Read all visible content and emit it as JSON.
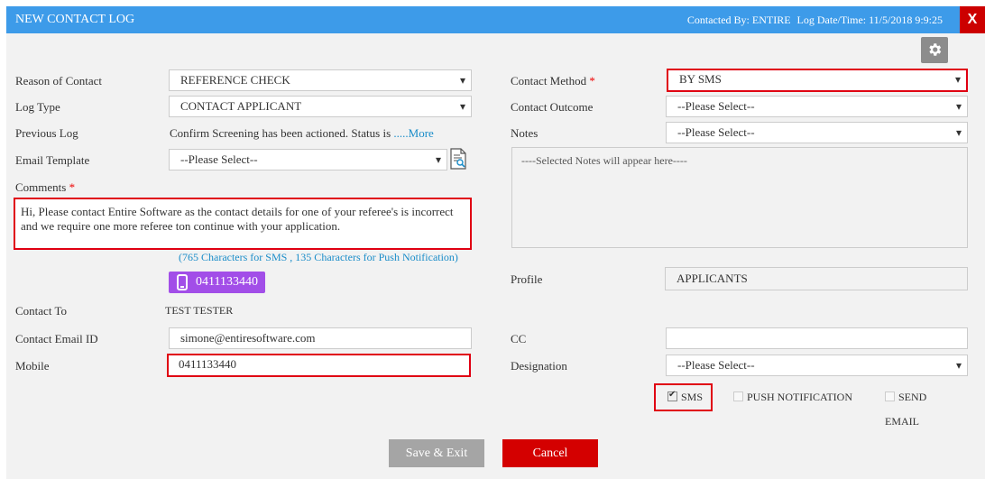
{
  "header": {
    "title": "NEW CONTACT LOG",
    "contacted_by": "Contacted By: ENTIRE",
    "log_datetime": "Log Date/Time: 11/5/2018 9:9:25",
    "close_label": "X"
  },
  "left": {
    "reason_label": "Reason of Contact",
    "reason_value": "REFERENCE CHECK",
    "logtype_label": "Log Type",
    "logtype_value": "CONTACT APPLICANT",
    "prevlog_label": "Previous Log",
    "prevlog_value": "Confirm Screening has been actioned. Status is ",
    "prevlog_more": ".....More",
    "emailtpl_label": "Email Template",
    "emailtpl_value": "--Please Select--",
    "comments_label": "Comments",
    "comments_value": "Hi, Please contact Entire Software as the contact details for one of your referee's is incorrect and we require one more referee ton continue with your application.",
    "char_info": "(765 Characters for SMS , 135 Characters for Push Notification)",
    "phone_button": "0411133440",
    "contactto_label": "Contact To",
    "contactto_value": "TEST TESTER",
    "email_label": "Contact Email ID",
    "email_value": "simone@entiresoftware.com",
    "mobile_label": "Mobile",
    "mobile_value": "0411133440"
  },
  "right": {
    "method_label": "Contact Method",
    "method_value": "BY SMS",
    "outcome_label": "Contact Outcome",
    "outcome_value": "--Please Select--",
    "notes_label": "Notes",
    "notes_value": "--Please Select--",
    "notes_placeholder": "----Selected Notes will appear here----",
    "profile_label": "Profile",
    "profile_value": "APPLICANTS",
    "cc_label": "CC",
    "cc_value": "",
    "designation_label": "Designation",
    "designation_value": "--Please Select--",
    "sms_label": "SMS",
    "sms_checked": true,
    "push_label": "PUSH NOTIFICATION",
    "push_checked": false,
    "send_label": "SEND",
    "email_label2": "EMAIL",
    "send_checked": false
  },
  "footer": {
    "save_label": "Save & Exit",
    "cancel_label": "Cancel"
  },
  "required_marker": "*",
  "colors": {
    "header_bg": "#3d9be9",
    "close_bg": "#cc0000",
    "highlight": "#e00012",
    "phone_btn": "#a24ee8",
    "cancel_bg": "#d40000",
    "save_bg": "#a5a5a5",
    "link": "#1a8dc9"
  },
  "icons": [
    "gear-icon",
    "mobile-phone-icon",
    "document-preview-icon",
    "close-icon",
    "dropdown-caret-icon",
    "checkbox-icon"
  ]
}
